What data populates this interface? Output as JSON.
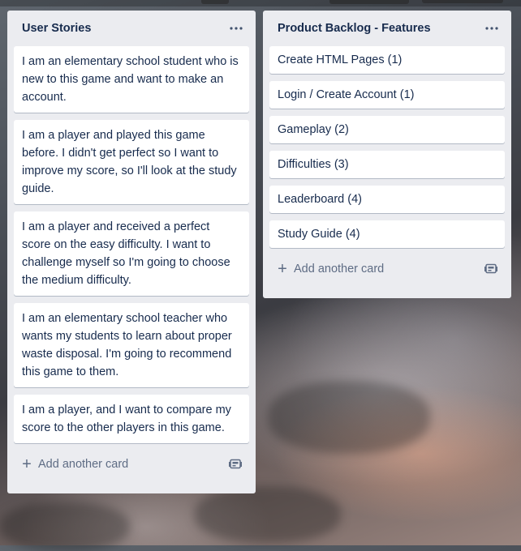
{
  "lists": [
    {
      "title": "User Stories",
      "cards": [
        "I am an elementary school student who is new to this game and want to make an account.",
        "I am a player and played this game before. I didn't get perfect so I want to improve my score, so I'll look at the study guide.",
        "I am a player and received a perfect score on the easy difficulty. I want to challenge myself so I'm going to choose the medium difficulty.",
        "I am an elementary school teacher who wants my students to learn about proper waste disposal. I'm going to recommend this game to them.",
        "I am a player, and I want to compare my score to the other players in this game."
      ],
      "add_card_label": "Add another card"
    },
    {
      "title": "Product Backlog - Features",
      "cards": [
        "Create HTML Pages (1)",
        "Login / Create Account (1)",
        "Gameplay (2)",
        "Difficulties (3)",
        "Leaderboard (4)",
        "Study Guide (4)"
      ],
      "add_card_label": "Add another card"
    }
  ],
  "icons": {
    "list_menu": "ellipsis-icon",
    "add": "plus-icon",
    "template": "card-template-icon"
  },
  "colors": {
    "list_bg": "#ebecf0",
    "card_bg": "#ffffff",
    "text": "#172b4d",
    "muted": "#5e6c84"
  }
}
